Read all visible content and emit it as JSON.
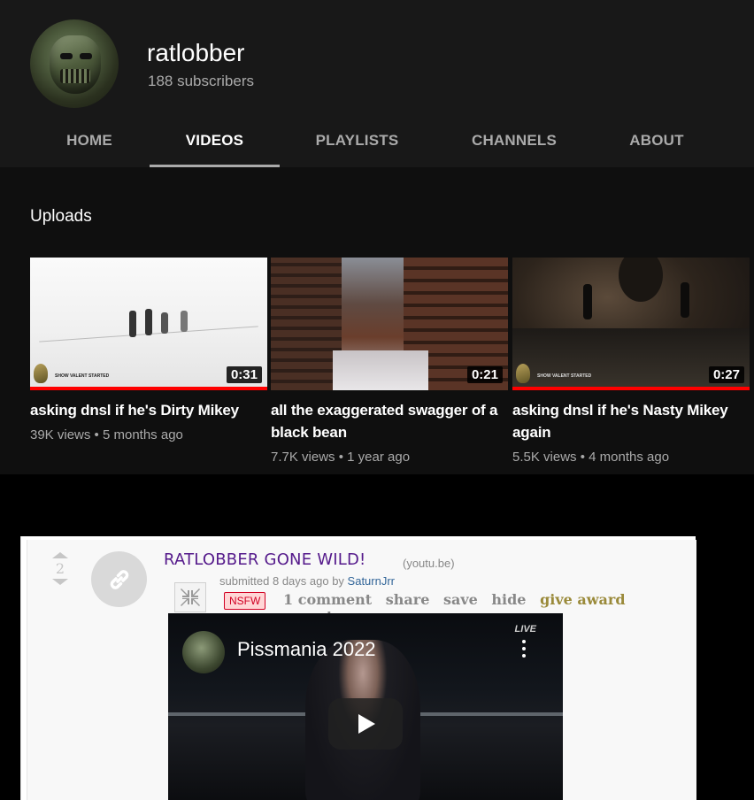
{
  "channel": {
    "name": "ratlobber",
    "subscribers": "188 subscribers"
  },
  "tabs": [
    {
      "label": "HOME",
      "active": false
    },
    {
      "label": "VIDEOS",
      "active": true
    },
    {
      "label": "PLAYLISTS",
      "active": false
    },
    {
      "label": "CHANNELS",
      "active": false
    },
    {
      "label": "ABOUT",
      "active": false
    }
  ],
  "uploads": {
    "section_title": "Uploads",
    "videos": [
      {
        "title": "asking dnsl if he's Dirty Mikey",
        "views": "39K views",
        "age": "5 months ago",
        "duration": "0:31",
        "watched_fraction": 1.0
      },
      {
        "title": "all the exaggerated swagger of a black bean",
        "views": "7.7K views",
        "age": "1 year ago",
        "duration": "0:21",
        "watched_fraction": 0.0
      },
      {
        "title": "asking dnsl if he's Nasty Mikey again",
        "views": "5.5K views",
        "age": "4 months ago",
        "duration": "0:27",
        "watched_fraction": 1.0
      }
    ],
    "meta_separator": "•",
    "thumb_logo_text": "SHOW VALENT STARTED"
  },
  "reddit_post": {
    "score": "2",
    "title": "RATLOBBER GONE WILD!",
    "domain": "(youtu.be)",
    "submitted_prefix": "submitted 8 days ago by",
    "author": "SaturnJrr",
    "nsfw_label": "NSFW",
    "buttons": {
      "comments": "1 comment",
      "share": "share",
      "save": "save",
      "hide": "hide",
      "give_award": "give award",
      "report": "report"
    },
    "embed": {
      "video_title": "Pissmania 2022",
      "live_badge": "LIVE"
    }
  }
}
